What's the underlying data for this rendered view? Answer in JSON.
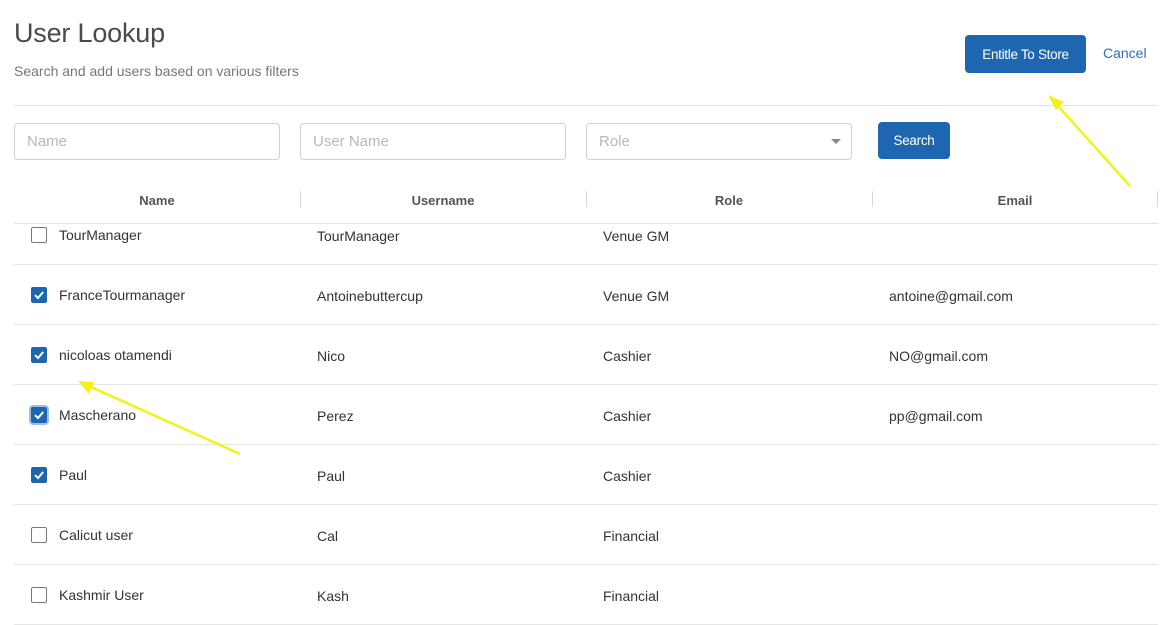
{
  "header": {
    "title": "User Lookup",
    "subtitle": "Search and add users based on various filters",
    "entitle_label": "Entitle To Store",
    "cancel_label": "Cancel"
  },
  "filters": {
    "name_placeholder": "Name",
    "username_placeholder": "User Name",
    "role_placeholder": "Role",
    "search_label": "Search"
  },
  "table": {
    "columns": [
      "Name",
      "Username",
      "Role",
      "Email"
    ],
    "rows": [
      {
        "name": "TourManager",
        "username": "TourManager",
        "role": "Venue GM",
        "email": "",
        "checked": false
      },
      {
        "name": "FranceTourmanager",
        "username": "Antoinebuttercup",
        "role": "Venue GM",
        "email": "antoine@gmail.com",
        "checked": true
      },
      {
        "name": "nicoloas otamendi",
        "username": "Nico",
        "role": "Cashier",
        "email": "NO@gmail.com",
        "checked": true
      },
      {
        "name": "Mascherano",
        "username": "Perez",
        "role": "Cashier",
        "email": "pp@gmail.com",
        "checked": true
      },
      {
        "name": "Paul",
        "username": "Paul",
        "role": "Cashier",
        "email": "",
        "checked": true
      },
      {
        "name": "Calicut user",
        "username": "Cal",
        "role": "Financial",
        "email": "",
        "checked": false
      },
      {
        "name": "Kashmir User",
        "username": "Kash",
        "role": "Financial",
        "email": "",
        "checked": false
      }
    ]
  },
  "colors": {
    "primary": "#1f66b1",
    "link": "#2a6fb8",
    "annotation": "#f2f21a"
  }
}
